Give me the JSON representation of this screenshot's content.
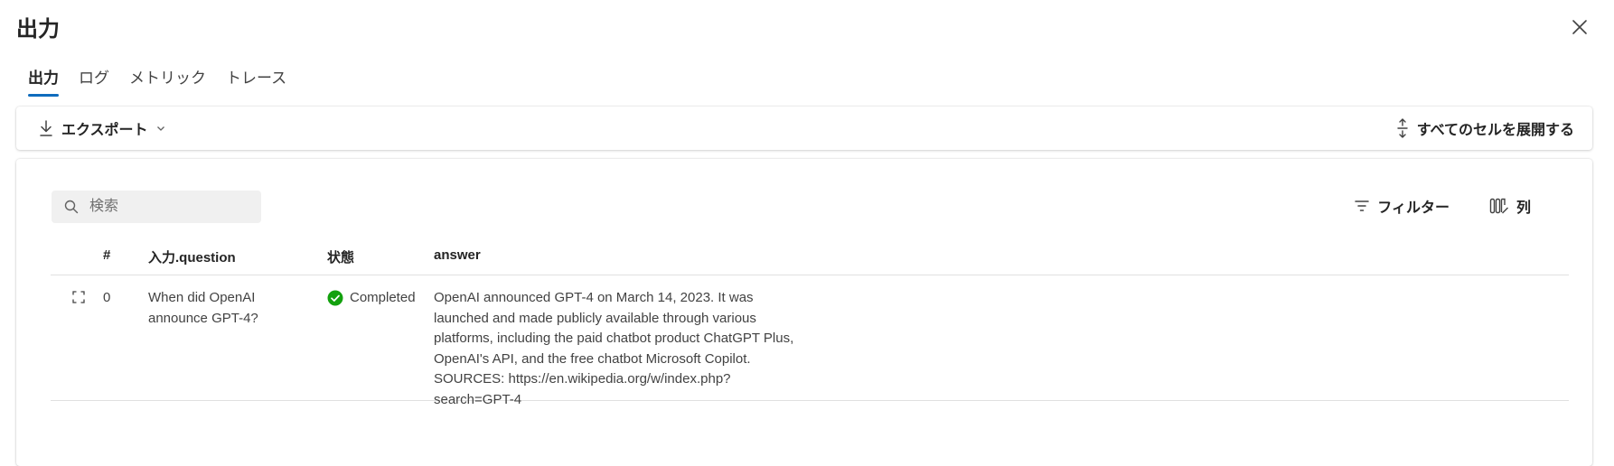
{
  "title": "出力",
  "tabs": [
    {
      "label": "出力",
      "active": true
    },
    {
      "label": "ログ",
      "active": false
    },
    {
      "label": "メトリック",
      "active": false
    },
    {
      "label": "トレース",
      "active": false
    }
  ],
  "toolbar": {
    "export_label": "エクスポート",
    "expand_all_label": "すべてのセルを展開する"
  },
  "search": {
    "placeholder": "検索"
  },
  "tools": {
    "filter_label": "フィルター",
    "columns_label": "列"
  },
  "table": {
    "headers": [
      "#",
      "入力.question",
      "状態",
      "answer"
    ],
    "rows": [
      {
        "index": "0",
        "question": "When did OpenAI announce GPT-4?",
        "status": "Completed",
        "answer": "OpenAI announced GPT-4 on March 14, 2023. It was launched and made publicly available through various platforms, including the paid chatbot product ChatGPT Plus, OpenAI's API, and the free chatbot Microsoft Copilot. SOURCES: https://en.wikipedia.org/w/index.php?search=GPT-4"
      }
    ]
  },
  "colors": {
    "accent": "#0f6cbd",
    "success": "#13a10e"
  }
}
